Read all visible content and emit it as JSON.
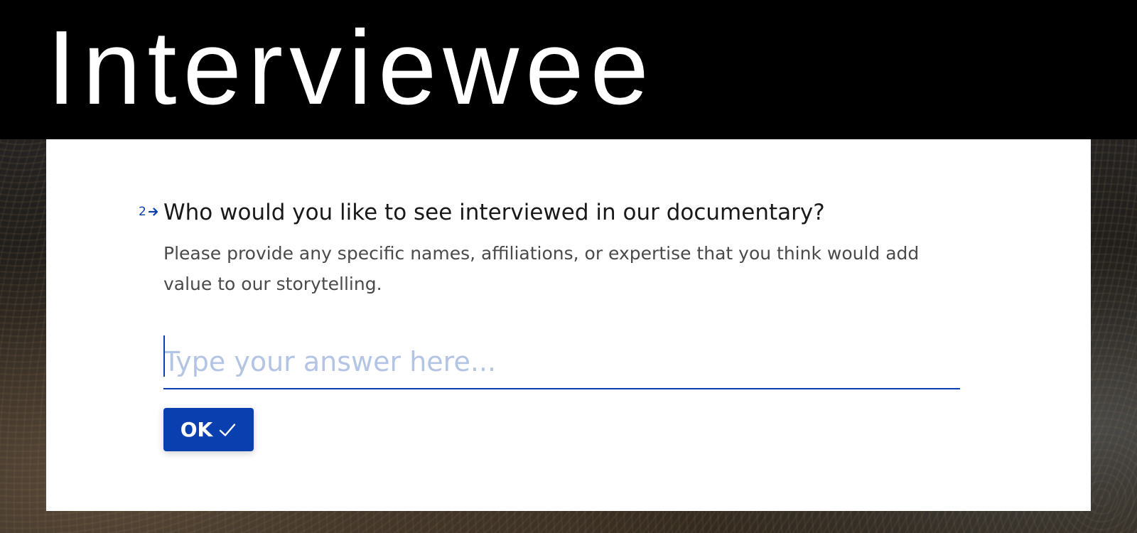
{
  "header": {
    "title": "Interviewee"
  },
  "question": {
    "number": "2",
    "number_icon": "arrow-right-icon",
    "title": "Who would you like to see interviewed in our documentary?",
    "description": "Please provide any specific names, affiliations, or expertise that you think would add value to our storytelling."
  },
  "answer": {
    "value": "",
    "placeholder": "Type your answer here..."
  },
  "ok_button": {
    "label": "OK",
    "icon": "checkmark-icon"
  },
  "colors": {
    "accent": "#0a3fb0",
    "placeholder": "#b4c4e4",
    "header_background": "#000000",
    "header_text": "#ffffff",
    "card_background": "#ffffff"
  }
}
